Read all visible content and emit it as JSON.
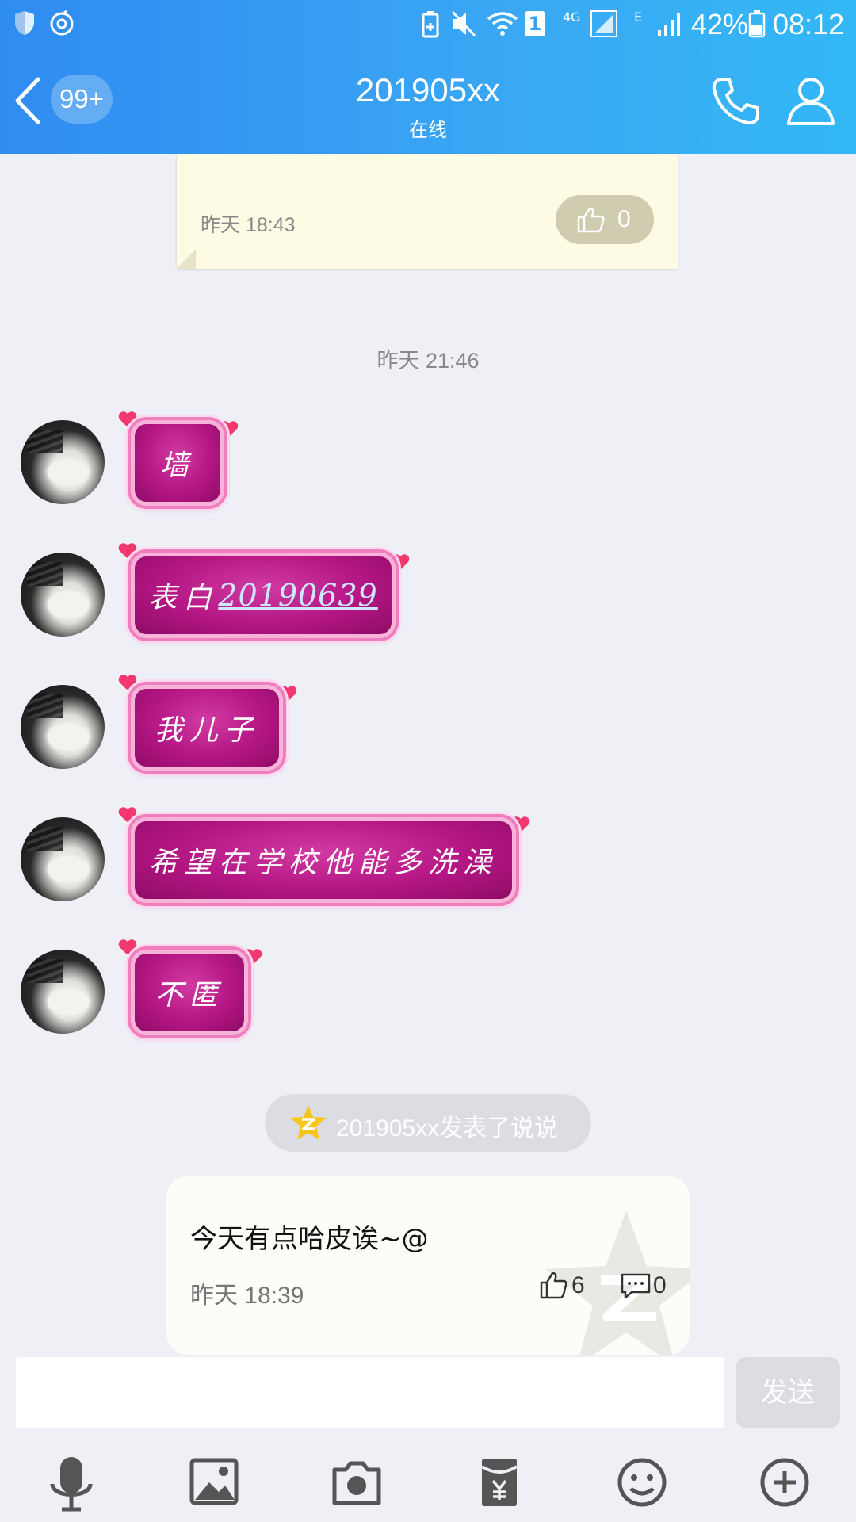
{
  "status_bar": {
    "battery": "42%",
    "time": "08:12",
    "network": "4G",
    "edge": "E",
    "sim": "1"
  },
  "header": {
    "badge": "99+",
    "title": "201905xx",
    "subtitle": "在线"
  },
  "top_card": {
    "time": "昨天 18:43",
    "likes": "0"
  },
  "divider_time": "昨天 21:46",
  "messages": [
    {
      "text": "墙"
    },
    {
      "prefix": "表白",
      "link": "20190639"
    },
    {
      "text": "我儿子"
    },
    {
      "text": "希望在学校他能多洗澡"
    },
    {
      "text": "不匿"
    }
  ],
  "notice": {
    "text": "201905xx发表了说说"
  },
  "qzone_post": {
    "content": "今天有点哈皮诶~@",
    "time": "昨天 18:39",
    "likes": "6",
    "comments": "0"
  },
  "composer": {
    "placeholder": "",
    "send_label": "发送"
  },
  "toolbar": {
    "icons": [
      "microphone-icon",
      "image-icon",
      "camera-icon",
      "red-packet-icon",
      "emoji-icon",
      "plus-icon"
    ]
  },
  "colors": {
    "header": "#3aa8f4",
    "bubble": "#b41684",
    "card": "#fdfbe3",
    "background": "#eef0f6"
  }
}
